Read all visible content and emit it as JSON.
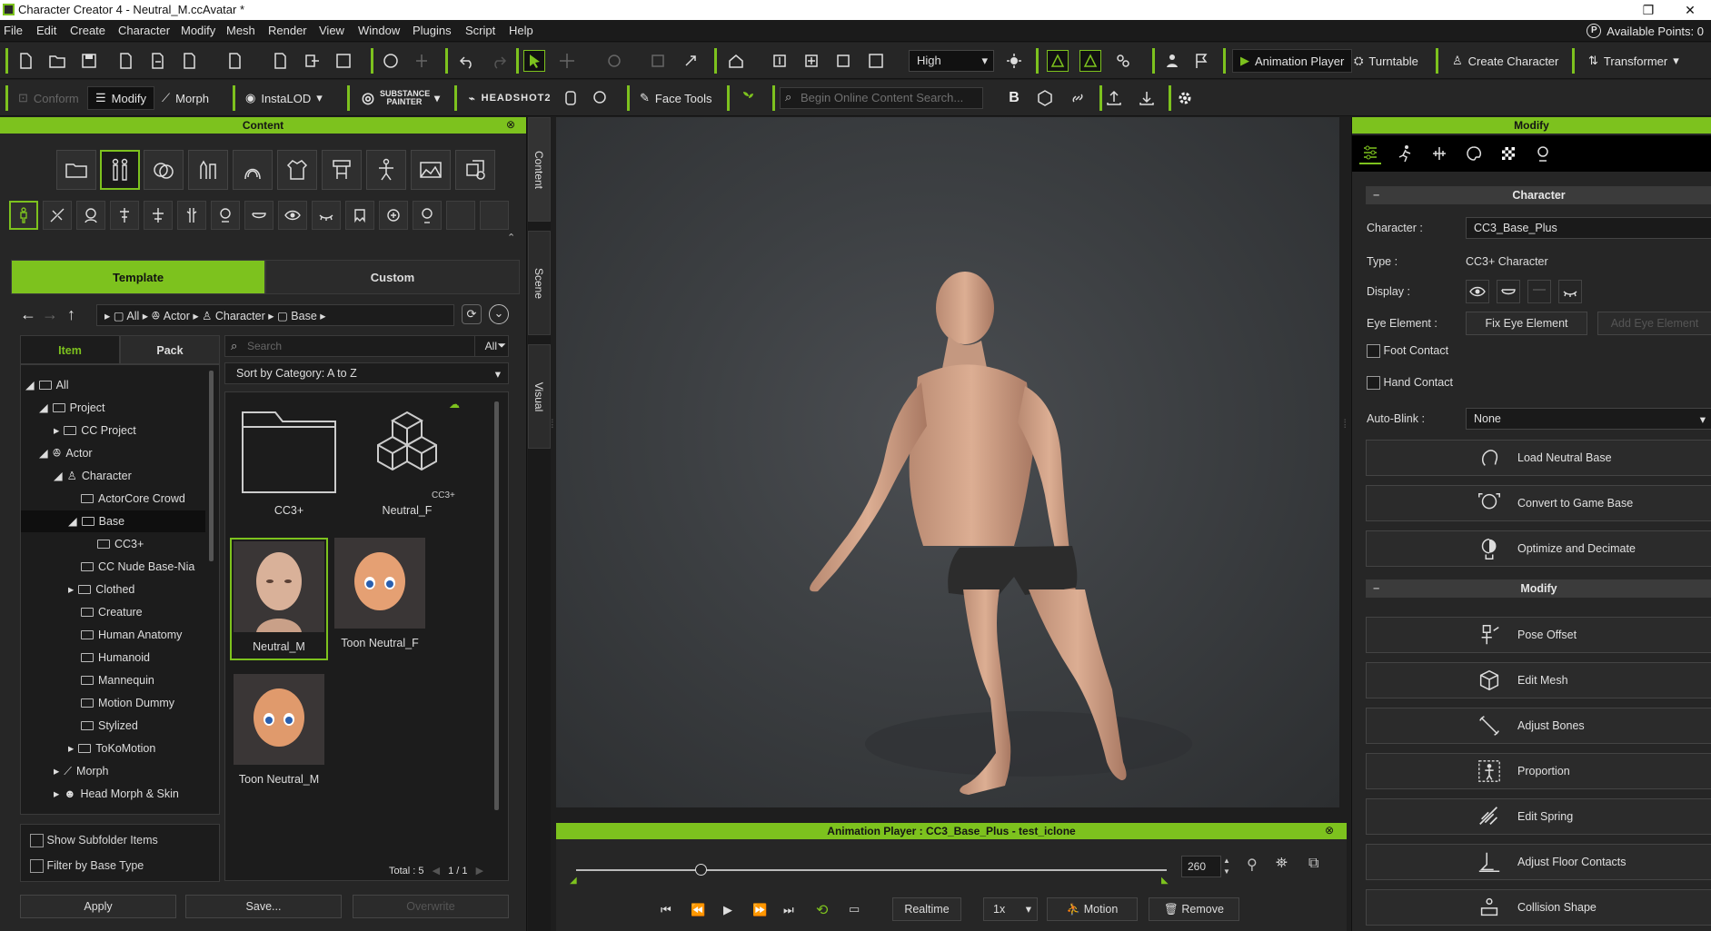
{
  "window": {
    "title": "Character Creator 4 - Neutral_M.ccAvatar *",
    "available_points": "Available Points: 0"
  },
  "menu": [
    "File",
    "Edit",
    "Create",
    "Character",
    "Modify",
    "Mesh",
    "Render",
    "View",
    "Window",
    "Plugins",
    "Script",
    "Help"
  ],
  "toolbar1": {
    "quality": "High",
    "animation_player": "Animation Player",
    "turntable": "Turntable",
    "create_character": "Create Character",
    "transformer": "Transformer"
  },
  "toolbar2": {
    "conform": "Conform",
    "modify": "Modify",
    "morph": "Morph",
    "instalod": "InstaLOD",
    "substance": "SUBSTANCE PAINTER",
    "headshot": "HEADSHOT2",
    "face_tools": "Face Tools",
    "search_placeholder": "Begin Online Content Search..."
  },
  "content": {
    "header": "Content",
    "tabs": [
      "Template",
      "Custom"
    ],
    "breadcrumb": [
      "All",
      "Actor",
      "Character",
      "Base"
    ],
    "subtabs": [
      "Item",
      "Pack"
    ],
    "search_placeholder": "Search",
    "filter": "All",
    "sort": "Sort by Category: A to Z",
    "tree": [
      "All",
      "Project",
      "CC Project",
      "Actor",
      "Character",
      "ActorCore Crowd",
      "Base",
      "CC3+",
      "CC Nude Base-Nia",
      "Clothed",
      "Creature",
      "Human Anatomy",
      "Humanoid",
      "Mannequin",
      "Motion Dummy",
      "Stylized",
      "ToKoMotion",
      "Morph",
      "Head Morph & Skin"
    ],
    "items": [
      "CC3+",
      "Neutral_F",
      "Neutral_M",
      "Toon Neutral_F",
      "Toon Neutral_M"
    ],
    "badge": "CC3+",
    "show_subfolder": "Show Subfolder Items",
    "filter_base": "Filter by Base Type",
    "total": "Total : 5",
    "page": "1",
    "pages": "1",
    "apply": "Apply",
    "save": "Save...",
    "overwrite": "Overwrite"
  },
  "vtabs": [
    "Content",
    "Scene",
    "Visual"
  ],
  "anim": {
    "title": "Animation Player : CC3_Base_Plus - test_iclone",
    "frame": "260",
    "realtime": "Realtime",
    "speed": "1x",
    "motion": "Motion",
    "remove": "Remove",
    "progress": 0.21
  },
  "modify": {
    "header": "Modify",
    "section_character": "Character",
    "character_label": "Character :",
    "character_value": "CC3_Base_Plus",
    "type_label": "Type :",
    "type_value": "CC3+ Character",
    "display_label": "Display :",
    "eye_label": "Eye Element :",
    "fix_eye": "Fix Eye Element",
    "add_eye": "Add Eye Element",
    "foot_contact": "Foot Contact",
    "hand_contact": "Hand Contact",
    "autoblink_label": "Auto-Blink :",
    "autoblink_value": "None",
    "buttons1": [
      "Load Neutral Base",
      "Convert to Game Base",
      "Optimize and Decimate"
    ],
    "section_modify": "Modify",
    "buttons2": [
      "Pose Offset",
      "Edit Mesh",
      "Adjust Bones",
      "Proportion",
      "Edit Spring",
      "Adjust Floor Contacts",
      "Collision Shape"
    ]
  }
}
